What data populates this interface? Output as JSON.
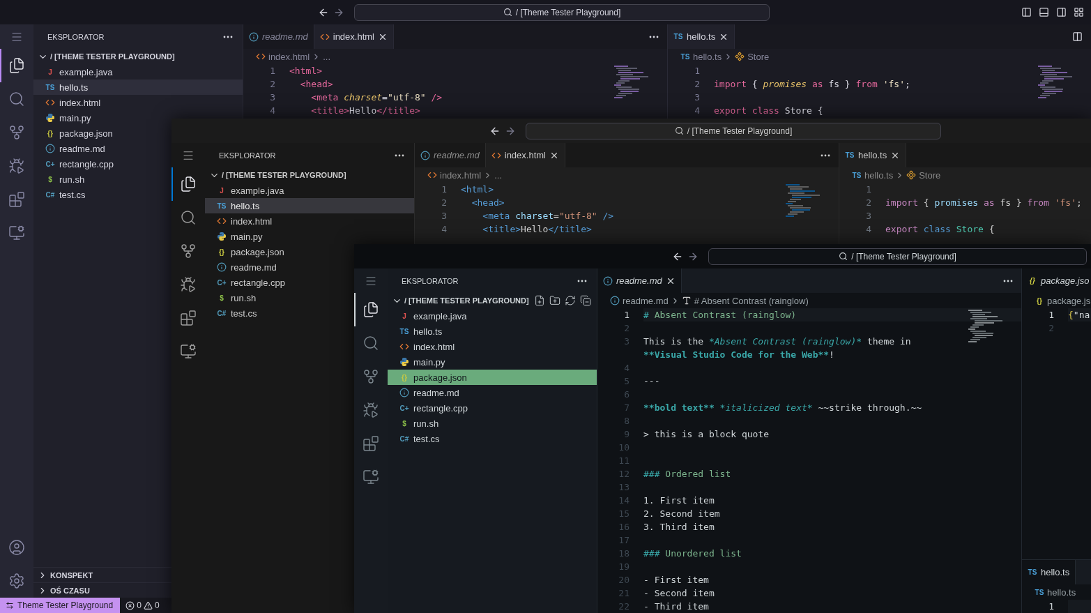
{
  "windows": [
    {
      "search": "/ [Theme Tester Playground]",
      "layout_controls": true,
      "activity": [
        {
          "kind": "menu",
          "selected": false
        },
        {
          "kind": "explorer",
          "selected": true
        },
        {
          "kind": "search",
          "selected": false
        },
        {
          "kind": "source-control",
          "selected": false
        },
        {
          "kind": "run-debug",
          "selected": false
        },
        {
          "kind": "extensions",
          "selected": false
        },
        {
          "kind": "remote",
          "selected": false
        }
      ],
      "activity_bottom": [
        {
          "kind": "account"
        },
        {
          "kind": "settings"
        }
      ],
      "sidebar": {
        "title": "EKSPLORATOR",
        "folder": {
          "label": "/ [THEME TESTER PLAYGROUND]",
          "expanded": true
        },
        "files": [
          {
            "name": "example.java",
            "kind": "java",
            "glyph": "J",
            "selected": false
          },
          {
            "name": "hello.ts",
            "kind": "ts",
            "glyph": "TS",
            "selected": true
          },
          {
            "name": "index.html",
            "kind": "html",
            "selected": false
          },
          {
            "name": "main.py",
            "kind": "py",
            "selected": false
          },
          {
            "name": "package.json",
            "kind": "json",
            "glyph": "{}",
            "selected": false
          },
          {
            "name": "readme.md",
            "kind": "md",
            "selected": false
          },
          {
            "name": "rectangle.cpp",
            "kind": "cpp",
            "glyph": "C+",
            "selected": false
          },
          {
            "name": "run.sh",
            "kind": "sh",
            "glyph": "$",
            "selected": false
          },
          {
            "name": "test.cs",
            "kind": "cs",
            "glyph": "C#",
            "selected": false
          }
        ],
        "sections": [
          {
            "label": "KONSPEKT",
            "expanded": false
          },
          {
            "label": "OŚ CZASU",
            "expanded": false
          }
        ]
      },
      "columns": [
        {
          "editors": [
            {
              "tabs": [
                {
                  "label": "readme.md",
                  "kind": "md",
                  "selected": false,
                  "preview": true,
                  "closable": false
                },
                {
                  "label": "index.html",
                  "kind": "html",
                  "selected": true,
                  "preview": false,
                  "closable": true
                }
              ],
              "actions": [
                {
                  "kind": "more"
                }
              ],
              "breadcrumb": [
                {
                  "label": "index.html",
                  "kind": "html"
                },
                {
                  "label": "..."
                }
              ],
              "minimap": true,
              "lines": [
                {
                  "n": "1",
                  "tokens": [
                    {
                      "text": "<html>",
                      "kind": "tag"
                    }
                  ]
                },
                {
                  "n": "2",
                  "tokens": [
                    {
                      "text": "  <head>",
                      "kind": "tag"
                    }
                  ]
                },
                {
                  "n": "3",
                  "tokens": [
                    {
                      "text": "    <meta",
                      "kind": "tag"
                    },
                    {
                      "text": " charset",
                      "kind": "attr"
                    },
                    {
                      "text": "=",
                      "kind": "plain"
                    },
                    {
                      "text": "\"utf-8\"",
                      "kind": "string"
                    },
                    {
                      "text": " />",
                      "kind": "tag"
                    }
                  ]
                },
                {
                  "n": "4",
                  "tokens": [
                    {
                      "text": "    <title>",
                      "kind": "tag"
                    },
                    {
                      "text": "Hello",
                      "kind": "plain"
                    },
                    {
                      "text": "</title>",
                      "kind": "tag"
                    }
                  ]
                }
              ]
            }
          ]
        },
        {
          "editors": [
            {
              "tabs": [
                {
                  "label": "hello.ts",
                  "kind": "ts",
                  "glyph": "TS",
                  "selected": true,
                  "preview": false,
                  "closable": true
                }
              ],
              "actions": [
                {
                  "kind": "split"
                }
              ],
              "breadcrumb": [
                {
                  "label": "hello.ts",
                  "kind": "ts",
                  "glyph": "TS"
                },
                {
                  "label": "Store",
                  "kind": "class"
                }
              ],
              "minimap": true,
              "lines": [
                {
                  "n": "1"
                },
                {
                  "n": "2",
                  "tokens": [
                    {
                      "text": "import",
                      "kind": "keyword"
                    },
                    {
                      "text": " { ",
                      "kind": "plain"
                    },
                    {
                      "text": "promises",
                      "kind": "var"
                    },
                    {
                      "text": " as ",
                      "kind": "keyword"
                    },
                    {
                      "text": "fs",
                      "kind": "plain"
                    },
                    {
                      "text": " } ",
                      "kind": "plain"
                    },
                    {
                      "text": "from",
                      "kind": "keyword"
                    },
                    {
                      "text": " 'fs'",
                      "kind": "string"
                    },
                    {
                      "text": ";",
                      "kind": "plain"
                    }
                  ]
                },
                {
                  "n": "3"
                },
                {
                  "n": "4",
                  "tokens": [
                    {
                      "text": "export",
                      "kind": "keyword"
                    },
                    {
                      "text": " class ",
                      "kind": "storage"
                    },
                    {
                      "text": "Store",
                      "kind": "class"
                    },
                    {
                      "text": " {",
                      "kind": "plain"
                    }
                  ]
                }
              ]
            }
          ]
        }
      ],
      "status_bar": {
        "remote": "Theme Tester Playground",
        "errors": "0",
        "warnings": "0"
      }
    },
    {
      "search": "/ [Theme Tester Playground]",
      "activity": [
        {
          "kind": "menu",
          "selected": false
        },
        {
          "kind": "explorer",
          "selected": true
        },
        {
          "kind": "search",
          "selected": false
        },
        {
          "kind": "source-control",
          "selected": false
        },
        {
          "kind": "run-debug",
          "selected": false
        },
        {
          "kind": "extensions",
          "selected": false
        },
        {
          "kind": "remote",
          "selected": false
        }
      ],
      "sidebar": {
        "title": "EKSPLORATOR",
        "folder": {
          "label": "/ [THEME TESTER PLAYGROUND]",
          "expanded": true
        },
        "files": [
          {
            "name": "example.java",
            "kind": "java",
            "glyph": "J",
            "selected": false
          },
          {
            "name": "hello.ts",
            "kind": "ts",
            "glyph": "TS",
            "selected": true
          },
          {
            "name": "index.html",
            "kind": "html",
            "selected": false
          },
          {
            "name": "main.py",
            "kind": "py",
            "selected": false
          },
          {
            "name": "package.json",
            "kind": "json",
            "glyph": "{}",
            "selected": false
          },
          {
            "name": "readme.md",
            "kind": "md",
            "selected": false
          },
          {
            "name": "rectangle.cpp",
            "kind": "cpp",
            "glyph": "C+",
            "selected": false
          },
          {
            "name": "run.sh",
            "kind": "sh",
            "glyph": "$",
            "selected": false
          },
          {
            "name": "test.cs",
            "kind": "cs",
            "glyph": "C#",
            "selected": false
          }
        ]
      },
      "columns": [
        {
          "editors": [
            {
              "tabs": [
                {
                  "label": "readme.md",
                  "kind": "md",
                  "selected": false,
                  "preview": true,
                  "closable": false
                },
                {
                  "label": "index.html",
                  "kind": "html",
                  "selected": true,
                  "preview": false,
                  "closable": true
                }
              ],
              "actions": [
                {
                  "kind": "more"
                }
              ],
              "breadcrumb": [
                {
                  "label": "index.html",
                  "kind": "html"
                },
                {
                  "label": "..."
                }
              ],
              "minimap": true,
              "lines": [
                {
                  "n": "1",
                  "tokens": [
                    {
                      "text": "<html>",
                      "kind": "tag"
                    }
                  ]
                },
                {
                  "n": "2",
                  "tokens": [
                    {
                      "text": "  <head>",
                      "kind": "tag"
                    }
                  ]
                },
                {
                  "n": "3",
                  "tokens": [
                    {
                      "text": "    <meta",
                      "kind": "tag"
                    },
                    {
                      "text": " charset",
                      "kind": "attr"
                    },
                    {
                      "text": "=",
                      "kind": "plain"
                    },
                    {
                      "text": "\"utf-8\"",
                      "kind": "string"
                    },
                    {
                      "text": " />",
                      "kind": "tag"
                    }
                  ]
                },
                {
                  "n": "4",
                  "tokens": [
                    {
                      "text": "    <title>",
                      "kind": "tag"
                    },
                    {
                      "text": "Hello",
                      "kind": "plain"
                    },
                    {
                      "text": "</title>",
                      "kind": "tag"
                    }
                  ]
                }
              ]
            }
          ]
        },
        {
          "editors": [
            {
              "tabs": [
                {
                  "label": "hello.ts",
                  "kind": "ts",
                  "glyph": "TS",
                  "selected": true,
                  "preview": false,
                  "closable": true
                }
              ],
              "breadcrumb": [
                {
                  "label": "hello.ts",
                  "kind": "ts",
                  "glyph": "TS"
                },
                {
                  "label": "Store",
                  "kind": "class"
                }
              ],
              "lines": [
                {
                  "n": "1"
                },
                {
                  "n": "2",
                  "tokens": [
                    {
                      "text": "import",
                      "kind": "keyword"
                    },
                    {
                      "text": " { ",
                      "kind": "plain"
                    },
                    {
                      "text": "promises",
                      "kind": "var"
                    },
                    {
                      "text": " as ",
                      "kind": "keyword"
                    },
                    {
                      "text": "fs",
                      "kind": "plain"
                    },
                    {
                      "text": " } ",
                      "kind": "plain"
                    },
                    {
                      "text": "from",
                      "kind": "keyword"
                    },
                    {
                      "text": " 'fs'",
                      "kind": "string"
                    },
                    {
                      "text": ";",
                      "kind": "plain"
                    }
                  ]
                },
                {
                  "n": "3"
                },
                {
                  "n": "4",
                  "tokens": [
                    {
                      "text": "export",
                      "kind": "keyword"
                    },
                    {
                      "text": " class ",
                      "kind": "storage"
                    },
                    {
                      "text": "Store",
                      "kind": "class"
                    },
                    {
                      "text": " {",
                      "kind": "plain"
                    }
                  ]
                }
              ]
            }
          ]
        }
      ]
    },
    {
      "search": "/ [Theme Tester Playground]",
      "activity": [
        {
          "kind": "menu",
          "selected": false
        },
        {
          "kind": "explorer",
          "selected": true
        },
        {
          "kind": "search",
          "selected": false
        },
        {
          "kind": "source-control",
          "selected": false
        },
        {
          "kind": "run-debug",
          "selected": false
        },
        {
          "kind": "extensions",
          "selected": false
        },
        {
          "kind": "remote",
          "selected": false
        }
      ],
      "sidebar": {
        "title": "EKSPLORATOR",
        "folder": {
          "label": "/ [THEME TESTER PLAYGROUND]",
          "expanded": true,
          "actions": [
            {
              "kind": "new-file"
            },
            {
              "kind": "new-folder"
            },
            {
              "kind": "refresh"
            },
            {
              "kind": "collapse"
            }
          ]
        },
        "files": [
          {
            "name": "example.java",
            "kind": "java",
            "glyph": "J",
            "selected": false
          },
          {
            "name": "hello.ts",
            "kind": "ts",
            "glyph": "TS",
            "selected": false
          },
          {
            "name": "index.html",
            "kind": "html",
            "selected": false
          },
          {
            "name": "main.py",
            "kind": "py",
            "selected": false
          },
          {
            "name": "package.json",
            "kind": "json",
            "glyph": "{}",
            "selected": true
          },
          {
            "name": "readme.md",
            "kind": "md",
            "selected": false
          },
          {
            "name": "rectangle.cpp",
            "kind": "cpp",
            "glyph": "C+",
            "selected": false
          },
          {
            "name": "run.sh",
            "kind": "sh",
            "glyph": "$",
            "selected": false
          },
          {
            "name": "test.cs",
            "kind": "cs",
            "glyph": "C#",
            "selected": false
          }
        ]
      },
      "columns": [
        {
          "editors": [
            {
              "tabs": [
                {
                  "label": "readme.md",
                  "kind": "md",
                  "selected": true,
                  "preview": true,
                  "closable": true
                }
              ],
              "actions": [
                {
                  "kind": "more"
                }
              ],
              "breadcrumb": [
                {
                  "label": "readme.md",
                  "kind": "md"
                },
                {
                  "label": "# Absent Contrast (rainglow)",
                  "kind": "abc"
                }
              ],
              "minimap": true,
              "lines": [
                {
                  "n": "1",
                  "current": true,
                  "tokens": [
                    {
                      "text": "#",
                      "kind": "mark"
                    },
                    {
                      "text": " Absent Contrast (rainglow)",
                      "kind": "heading"
                    }
                  ]
                },
                {
                  "n": "2",
                  "current": false
                },
                {
                  "n": "3",
                  "current": false,
                  "tokens": [
                    {
                      "text": "This is the ",
                      "kind": "plain"
                    },
                    {
                      "text": "*Absent Contrast (rainglow)*",
                      "kind": "em"
                    },
                    {
                      "text": " theme in",
                      "kind": "plain"
                    }
                  ]
                },
                {
                  "tokens": [
                    {
                      "text": "**Visual Studio Code for the Web**",
                      "kind": "strong"
                    },
                    {
                      "text": "!",
                      "kind": "plain"
                    }
                  ]
                },
                {
                  "n": "4",
                  "current": false
                },
                {
                  "n": "5",
                  "current": false,
                  "tokens": [
                    {
                      "text": "---",
                      "kind": "plain"
                    }
                  ]
                },
                {
                  "n": "6",
                  "current": false
                },
                {
                  "n": "7",
                  "current": false,
                  "tokens": [
                    {
                      "text": "**bold text**",
                      "kind": "strong"
                    },
                    {
                      "text": " *italicized text*",
                      "kind": "em"
                    },
                    {
                      "text": " ~~strike through.~~",
                      "kind": "plain"
                    }
                  ]
                },
                {
                  "n": "8",
                  "current": false
                },
                {
                  "n": "9",
                  "current": false,
                  "tokens": [
                    {
                      "text": "> this is a block quote",
                      "kind": "plain"
                    }
                  ]
                },
                {
                  "n": "10",
                  "current": false
                },
                {
                  "n": "11",
                  "current": false
                },
                {
                  "n": "12",
                  "current": false,
                  "tokens": [
                    {
                      "text": "###",
                      "kind": "mark"
                    },
                    {
                      "text": " Ordered list",
                      "kind": "heading"
                    }
                  ]
                },
                {
                  "n": "13",
                  "current": false
                },
                {
                  "n": "14",
                  "current": false,
                  "tokens": [
                    {
                      "text": "1. First item",
                      "kind": "plain"
                    }
                  ]
                },
                {
                  "n": "15",
                  "current": false,
                  "tokens": [
                    {
                      "text": "2. Second item",
                      "kind": "plain"
                    }
                  ]
                },
                {
                  "n": "16",
                  "current": false,
                  "tokens": [
                    {
                      "text": "3. Third item",
                      "kind": "plain"
                    }
                  ]
                },
                {
                  "n": "17",
                  "current": false
                },
                {
                  "n": "18",
                  "current": false,
                  "tokens": [
                    {
                      "text": "###",
                      "kind": "mark"
                    },
                    {
                      "text": " Unordered list",
                      "kind": "heading"
                    }
                  ]
                },
                {
                  "n": "19",
                  "current": false
                },
                {
                  "n": "20",
                  "current": false,
                  "tokens": [
                    {
                      "text": "- First item",
                      "kind": "plain"
                    }
                  ]
                },
                {
                  "n": "21",
                  "current": false,
                  "tokens": [
                    {
                      "text": "- Second item",
                      "kind": "plain"
                    }
                  ]
                },
                {
                  "n": "22",
                  "current": false,
                  "tokens": [
                    {
                      "text": "- Third item",
                      "kind": "plain"
                    }
                  ]
                }
              ]
            }
          ]
        },
        {
          "editors": [
            {
              "tabs": [
                {
                  "label": "package.jso",
                  "kind": "json",
                  "glyph": "{}",
                  "selected": true,
                  "preview": true,
                  "closable": false
                }
              ],
              "breadcrumb": [
                {
                  "label": "package.js",
                  "kind": "json",
                  "glyph": "{}"
                }
              ],
              "lines": [
                {
                  "n": "1",
                  "current": true,
                  "tokens": [
                    {
                      "text": "{",
                      "kind": "brace"
                    },
                    {
                      "text": "\"na",
                      "kind": "string"
                    }
                  ]
                },
                {
                  "n": "2",
                  "current": false
                }
              ]
            },
            {
              "tabs": [
                {
                  "label": "hello.ts",
                  "kind": "ts",
                  "glyph": "TS",
                  "selected": true,
                  "preview": false,
                  "closable": false
                }
              ],
              "breadcrumb": [
                {
                  "label": "hello.ts",
                  "kind": "ts",
                  "glyph": "TS"
                }
              ],
              "lines": [
                {
                  "n": "1",
                  "current": true
                }
              ]
            }
          ]
        }
      ]
    }
  ]
}
